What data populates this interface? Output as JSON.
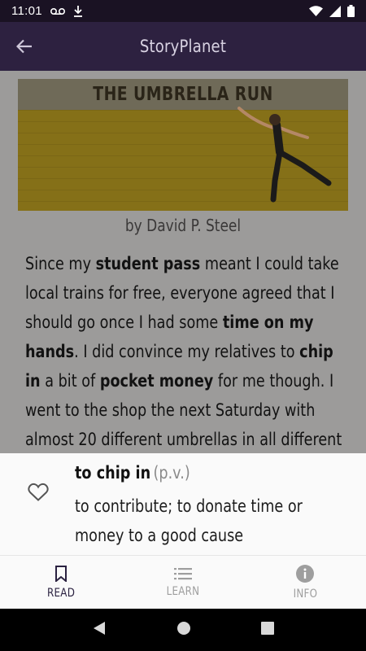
{
  "status_bar": {
    "time": "11:01"
  },
  "app_bar": {
    "title": "StoryPlanet"
  },
  "story": {
    "cover_title": "THE UMBRELLA RUN",
    "byline": "by David P. Steel",
    "paragraph": [
      {
        "text": "Since my ",
        "bold": false
      },
      {
        "text": "student pass",
        "bold": true
      },
      {
        "text": " meant I could take local trains for free, everyone agreed that I should go once I had some ",
        "bold": false
      },
      {
        "text": "time on my hands",
        "bold": true
      },
      {
        "text": ". I did convince my relatives to ",
        "bold": false
      },
      {
        "text": "chip in",
        "bold": true
      },
      {
        "text": " a bit of ",
        "bold": false
      },
      {
        "text": "pocket money",
        "bold": true
      },
      {
        "text": " for me though. I went to the shop the next Saturday with almost 20 different umbrellas in all different colors. When",
        "bold": false
      }
    ]
  },
  "definition": {
    "term": "to chip in",
    "part_of_speech": "(p.v.)",
    "meaning": "to contribute; to donate time or money to a good cause"
  },
  "bottom_nav": {
    "items": [
      {
        "label": "READ",
        "icon": "bookmark-icon",
        "active": true
      },
      {
        "label": "LEARN",
        "icon": "list-icon",
        "active": false
      },
      {
        "label": "INFO",
        "icon": "info-icon",
        "active": false
      }
    ]
  },
  "colors": {
    "status_bar": "#1a1223",
    "app_bar": "#2d2140",
    "content_dim": "#9c9b9a",
    "panel": "#fafafa",
    "accent": "#2a2140"
  }
}
